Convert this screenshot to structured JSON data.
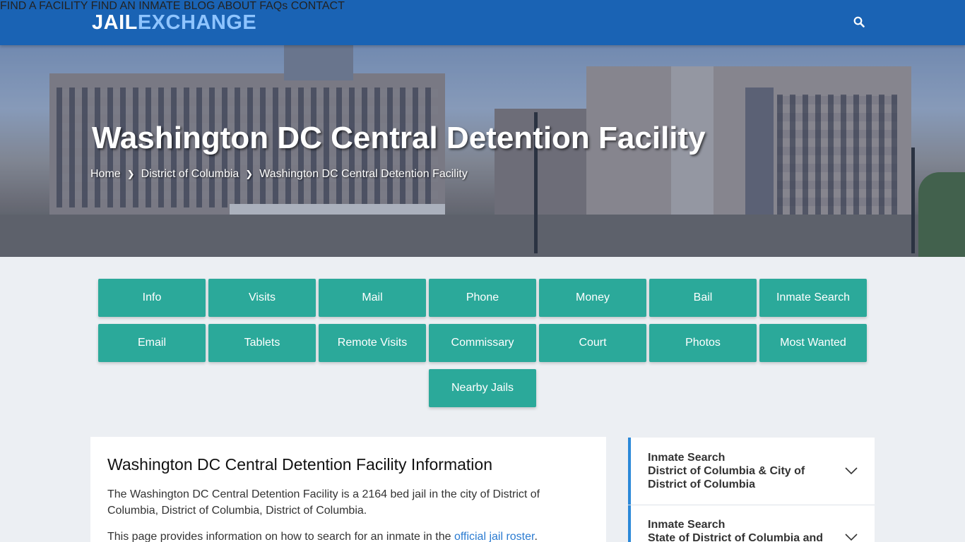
{
  "logo": {
    "part1": "JAIL",
    "part2": "EXCHANGE"
  },
  "nav": {
    "find_facility": "FIND A FACILITY",
    "find_inmate": "FIND AN INMATE",
    "blog": "BLOG",
    "about": "ABOUT",
    "faqs": "FAQs",
    "contact": "CONTACT",
    "search_icon": "search-icon"
  },
  "hero": {
    "title": "Washington DC Central Detention Facility",
    "breadcrumb": [
      "Home",
      "District of Columbia",
      "Washington DC Central Detention Facility"
    ]
  },
  "buttons": {
    "row1": [
      "Info",
      "Visits",
      "Mail",
      "Phone",
      "Money",
      "Bail",
      "Inmate Search"
    ],
    "row2": [
      "Email",
      "Tablets",
      "Remote Visits",
      "Commissary",
      "Court",
      "Photos",
      "Most Wanted"
    ],
    "row3": [
      "Nearby Jails"
    ]
  },
  "content": {
    "heading": "Washington DC Central Detention Facility Information",
    "para1": "The Washington DC Central Detention Facility is a 2164 bed jail in the city of District of Columbia, District of Columbia, District of Columbia.",
    "para2_prefix": "This page provides information on how to search for an inmate in the ",
    "para2_link": "official jail roster",
    "para2_suffix": "."
  },
  "sidebar": {
    "items": [
      {
        "line1": "Inmate Search",
        "line2": "District of Columbia & City of District of Columbia"
      },
      {
        "line1": "Inmate Search",
        "line2": "State of District of Columbia and"
      }
    ]
  },
  "colors": {
    "header": "#1a63b4",
    "button": "#2ba99a",
    "accent": "#2b88d8",
    "link": "#2a7bd1"
  }
}
